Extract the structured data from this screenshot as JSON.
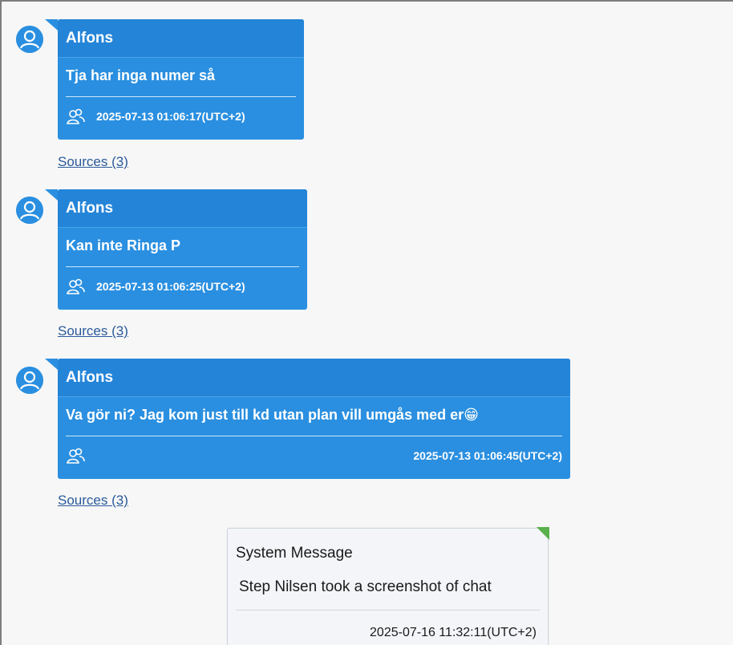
{
  "messages": [
    {
      "sender": "Alfons",
      "text": "Tja har inga  numer så",
      "timestamp": "2025-07-13 01:06:17(UTC+2)",
      "sources": "Sources (3)"
    },
    {
      "sender": "Alfons",
      "text": "Kan inte Ringa P",
      "timestamp": "2025-07-13 01:06:25(UTC+2)",
      "sources": "Sources (3)"
    },
    {
      "sender": "Alfons",
      "text": "Va gör ni? Jag kom just till kd utan plan vill umgås med er",
      "emoji": "😁",
      "timestamp": "2025-07-13 01:06:45(UTC+2)",
      "sources": "Sources (3)"
    }
  ],
  "system_message": {
    "title": "System Message",
    "text": "Step Nilsen took a screenshot of chat",
    "timestamp": "2025-07-16 11:32:11(UTC+2)"
  },
  "icons": {
    "avatar": "user-avatar-icon",
    "people": "group-people-icon"
  },
  "colors": {
    "bubble": "#2a8fe0",
    "sources_link": "#2a5a9a",
    "system_corner": "#58b04a"
  }
}
